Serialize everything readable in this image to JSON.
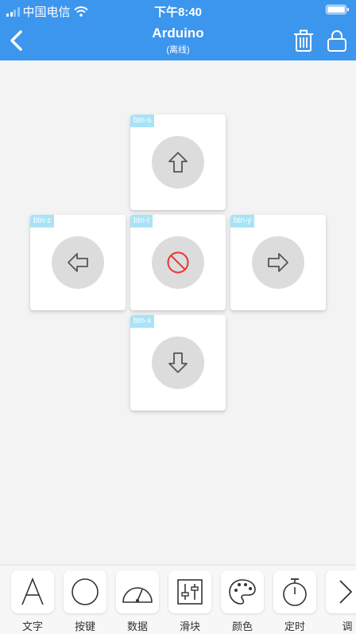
{
  "status_bar": {
    "carrier": "中国电信",
    "time": "下午8:40"
  },
  "header": {
    "title": "Arduino",
    "subtitle": "(离线)"
  },
  "buttons": [
    {
      "tag": "btn-s",
      "icon": "arrow-up-icon"
    },
    {
      "tag": "btn-z",
      "icon": "arrow-left-icon"
    },
    {
      "tag": "btn-t",
      "icon": "stop-icon"
    },
    {
      "tag": "btn-y",
      "icon": "arrow-right-icon"
    },
    {
      "tag": "btn-x",
      "icon": "arrow-down-icon"
    }
  ],
  "toolbar": {
    "items": [
      {
        "label": "文字",
        "icon": "text-icon"
      },
      {
        "label": "按键",
        "icon": "circle-button-icon"
      },
      {
        "label": "数据",
        "icon": "gauge-icon"
      },
      {
        "label": "滑块",
        "icon": "slider-icon"
      },
      {
        "label": "颜色",
        "icon": "palette-icon"
      },
      {
        "label": "定时",
        "icon": "stopwatch-icon"
      },
      {
        "label": "调",
        "icon": "chevron-right-icon"
      }
    ]
  },
  "colors": {
    "header_bg": "#3c96ee",
    "stop_red": "#e8352e",
    "tag_bg": "#a8e3f7"
  }
}
